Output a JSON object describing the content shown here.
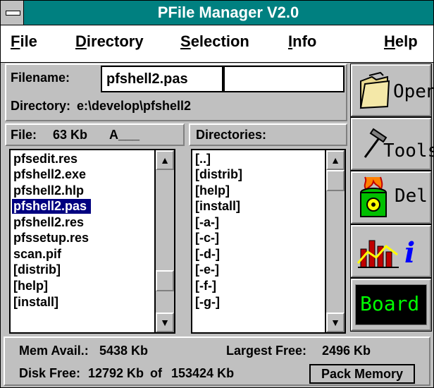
{
  "window": {
    "title": "PFile Manager V2.0"
  },
  "menu": {
    "file": "File",
    "directory": "Directory",
    "selection": "Selection",
    "info": "Info",
    "help": "Help"
  },
  "filename": {
    "label": "Filename:",
    "value": "pfshell2.pas",
    "extra_value": ""
  },
  "directory": {
    "label": "Directory:",
    "path": "e:\\develop\\pfshell2"
  },
  "file_info": {
    "label": "File:",
    "size": "63 Kb",
    "attributes": "A___"
  },
  "directories_label": "Directories:",
  "files": [
    "pfsedit.res",
    "pfshell2.exe",
    "pfshell2.hlp",
    "pfshell2.pas",
    "pfshell2.res",
    "pfssetup.res",
    "scan.pif",
    "[distrib]",
    "[help]",
    "[install]"
  ],
  "selected_file": "pfshell2.pas",
  "dirs": [
    "[..]",
    "[distrib]",
    "[help]",
    "[install]",
    "[-a-]",
    "[-c-]",
    "[-d-]",
    "[-e-]",
    "[-f-]",
    "[-g-]"
  ],
  "toolbar": {
    "open": "Open",
    "tools": "Tools",
    "del": "Del",
    "info": "i",
    "board": "Board"
  },
  "status": {
    "mem_label": "Mem Avail.:",
    "mem_value": "5438 Kb",
    "largest_label": "Largest Free:",
    "largest_value": "2496 Kb",
    "disk_label": "Disk Free:",
    "disk_free": "12792 Kb",
    "disk_of": "of",
    "disk_total": "153424 Kb",
    "pack_button": "Pack Memory"
  }
}
